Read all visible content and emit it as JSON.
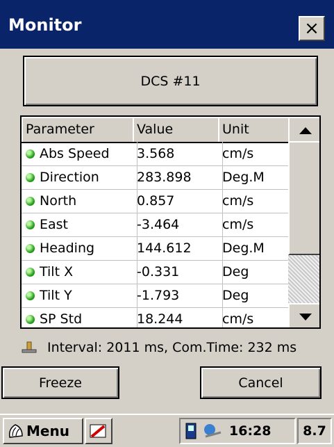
{
  "window": {
    "title": "Monitor",
    "close_glyph": "×"
  },
  "device": {
    "label": "DCS #11"
  },
  "grid": {
    "columns": [
      "Parameter",
      "Value",
      "Unit"
    ],
    "rows": [
      {
        "parameter": "Abs Speed",
        "value": "3.568",
        "unit": "cm/s",
        "status_icon": "green-dot-icon"
      },
      {
        "parameter": "Direction",
        "value": "283.898",
        "unit": "Deg.M",
        "status_icon": "green-dot-icon"
      },
      {
        "parameter": "North",
        "value": "0.857",
        "unit": "cm/s",
        "status_icon": "green-dot-icon"
      },
      {
        "parameter": "East",
        "value": "-3.464",
        "unit": "cm/s",
        "status_icon": "green-dot-icon"
      },
      {
        "parameter": "Heading",
        "value": "144.612",
        "unit": "Deg.M",
        "status_icon": "green-dot-icon"
      },
      {
        "parameter": "Tilt X",
        "value": "-0.331",
        "unit": "Deg",
        "status_icon": "green-dot-icon"
      },
      {
        "parameter": "Tilt Y",
        "value": "-1.793",
        "unit": "Deg",
        "status_icon": "green-dot-icon"
      },
      {
        "parameter": "SP Std",
        "value": "18.244",
        "unit": "cm/s",
        "status_icon": "green-dot-icon"
      }
    ]
  },
  "status": {
    "text": "Interval: 2011 ms, Com.Time: 232 ms",
    "icon": "connection-icon"
  },
  "buttons": {
    "freeze": "Freeze",
    "cancel": "Cancel"
  },
  "taskbar": {
    "menu_label": "Menu",
    "time": "16:28",
    "battery": "8.7"
  },
  "colors": {
    "titlebar": "#0a246a",
    "face": "#d4d0c8",
    "status_green": "#2aa51e"
  }
}
